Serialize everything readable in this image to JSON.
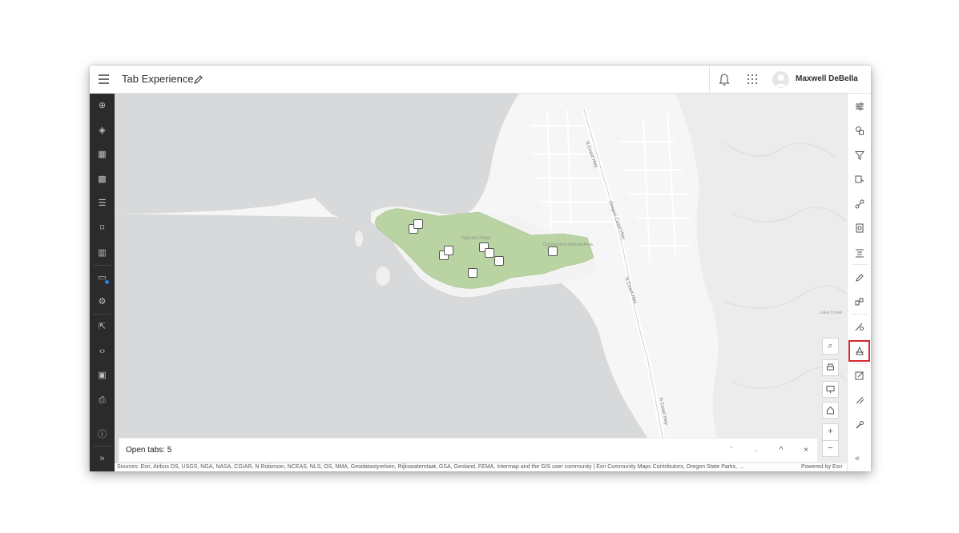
{
  "header": {
    "app_title": "Tab Experience",
    "user_name": "Maxwell DeBella"
  },
  "left_toolbar": {
    "items": [
      "add-icon",
      "layers-icon",
      "table-icon",
      "widgets-icon",
      "legend-icon",
      "bookmark-icon",
      "chart-icon",
      "tabs-icon",
      "settings-icon",
      "share-icon",
      "embed-icon",
      "grid-icon",
      "print-icon",
      "info-icon",
      "expand-icon"
    ],
    "expand_label": "»"
  },
  "right_toolbar": {
    "items": [
      "filter-settings-icon",
      "analysis-icon",
      "filter-icon",
      "edit-layer-icon",
      "directions-icon",
      "report-icon",
      "list-icon",
      "draw-icon",
      "features-icon",
      "measure-icon",
      "selected-tool-icon",
      "sketch-icon",
      "edit-icon",
      "wrench-icon"
    ],
    "collapse_label": "«",
    "selected_item": "selected-tool-icon"
  },
  "map": {
    "labels": {
      "road_1": "N Coast Hwy",
      "road_2": "Oregon Coast Hwy",
      "road_3": "N Coast Hwy",
      "road_4": "N Coast Hwy",
      "area_1": "Yaquina Head",
      "area_2": "Outstanding Natural Area",
      "creek": "Lake Creek"
    },
    "tools": {
      "search": "⌕",
      "zoom_in": "+",
      "zoom_out": "−"
    }
  },
  "open_tabs": {
    "label": "Open tabs: 5",
    "buttons": {
      "first": "⌃",
      "last": "⌄",
      "up": "^",
      "close": "×"
    }
  },
  "attribution": {
    "text": "Sources: Esri, Airbus DS, USGS, NGA, NASA, CGIAR, N Robinson, NCEAS, NLS, OS, NMA, Geodatastyrelsen, Rijkswaterstaat, GSA, Geoland, FEMA, Intermap and the GIS user community | Esri Community Maps Contributors, Oregon State Parks, …",
    "powered": "Powered by Esri"
  },
  "colors": {
    "left_bar": "#2b2b2b",
    "park_green": "#b9d3a3",
    "water": "#d7d9da",
    "land": "#f6f6f6",
    "highlight": "#d8262e",
    "accent_blue": "#2a7fe0"
  }
}
